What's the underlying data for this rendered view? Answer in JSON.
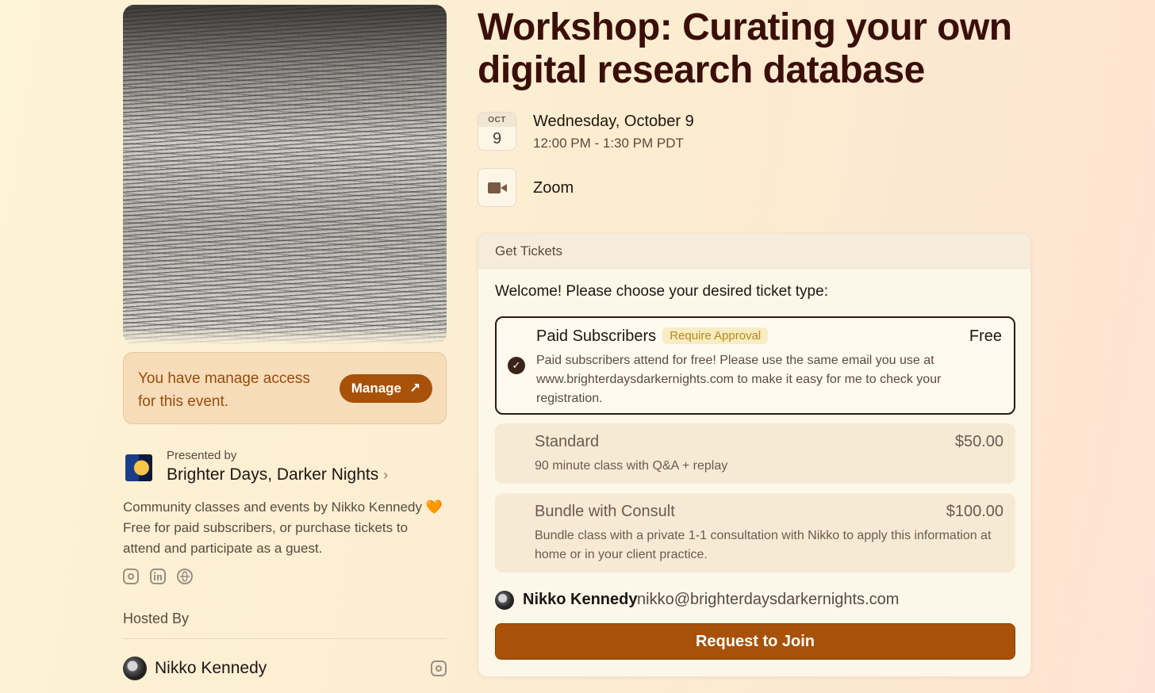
{
  "event": {
    "title": "Workshop: Curating your own digital research database",
    "date_month": "OCT",
    "date_day": "9",
    "date_main": "Wednesday, October 9",
    "date_time": "12:00 PM - 1:30 PM PDT",
    "location": "Zoom"
  },
  "manage": {
    "text": "You have manage access for this event.",
    "button": "Manage",
    "button_icon": "↗"
  },
  "presenter": {
    "label": "Presented by",
    "name": "Brighter Days, Darker Nights",
    "chevron": "›",
    "description": "Community classes and events by Nikko Kennedy 🧡 Free for paid subscribers, or purchase tickets to attend and participate as a guest."
  },
  "socials": [
    "instagram-icon",
    "linkedin-icon",
    "globe-icon"
  ],
  "hosted": {
    "label": "Hosted By",
    "host_name": "Nikko Kennedy"
  },
  "tickets": {
    "header": "Get Tickets",
    "welcome": "Welcome! Please choose your desired ticket type:",
    "items": [
      {
        "name": "Paid Subscribers",
        "badge": "Require Approval",
        "price": "Free",
        "description": "Paid subscribers attend for free! Please use the same email you use at www.brighterdaysdarkernights.com to make it easy for me to check your registration.",
        "selected": true
      },
      {
        "name": "Standard",
        "price": "$50.00",
        "description": "90 minute class with Q&A + replay",
        "selected": false
      },
      {
        "name": "Bundle with Consult",
        "price": "$100.00",
        "description": "Bundle class with a private 1-1 consultation with Nikko to apply this information at home or in your client practice.",
        "selected": false
      }
    ],
    "user_name": "Nikko Kennedy",
    "user_email": "nikko@brighterdaysdarkernights.com",
    "join_button": "Request to Join"
  },
  "colors": {
    "accent": "#a85108",
    "title": "#3a0f0a",
    "badge_text": "#b58a1a"
  }
}
